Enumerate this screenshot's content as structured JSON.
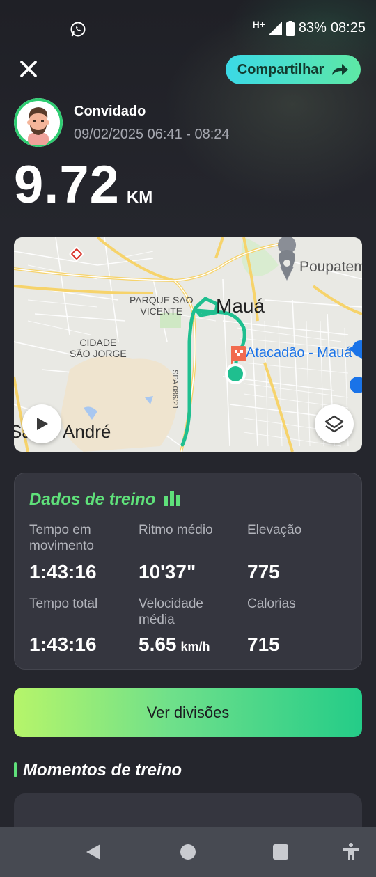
{
  "status_bar": {
    "network": "H+",
    "battery": "83%",
    "time": "08:25",
    "icons": [
      "whatsapp-icon",
      "signal-icon",
      "battery-icon"
    ]
  },
  "header": {
    "close_icon": "close-icon",
    "share_label": "Compartilhar",
    "share_icon": "share-arrow-icon"
  },
  "user": {
    "name": "Convidado",
    "date_range": "09/02/2025 06:41 - 08:24"
  },
  "distance": {
    "value": "9.72",
    "unit": "KM"
  },
  "map": {
    "labels": {
      "maua": "Mauá",
      "parque": "PARQUE SAO\nVICENTE",
      "cidade": "CIDADE\nSÃO JORGE",
      "andre": "André",
      "sa": "Sa",
      "poupa": "Poupatem",
      "atacadao": "Atacadão - Mauá",
      "spa": "SPA 086/21"
    },
    "route_color": "#1fbf8f",
    "buttons": [
      "play-icon",
      "layers-icon"
    ]
  },
  "training_data": {
    "title": "Dados de treino",
    "accent": "#5fe07a",
    "metrics": [
      {
        "label": "Tempo em\nmovimento",
        "value": "1:43:16",
        "unit": ""
      },
      {
        "label": "Ritmo médio",
        "value": "10'37\"",
        "unit": ""
      },
      {
        "label": "Elevação",
        "value": "775",
        "unit": ""
      },
      {
        "label": "Tempo total",
        "value": "1:43:16",
        "unit": ""
      },
      {
        "label": "Velocidade\nmédia",
        "value": "5.65",
        "unit": "km/h"
      },
      {
        "label": "Calorias",
        "value": "715",
        "unit": ""
      }
    ]
  },
  "splits_button": "Ver divisões",
  "moments": {
    "title": "Momentos de treino"
  },
  "nav_bar": [
    "back-icon",
    "home-icon",
    "recents-icon",
    "accessibility-icon"
  ]
}
